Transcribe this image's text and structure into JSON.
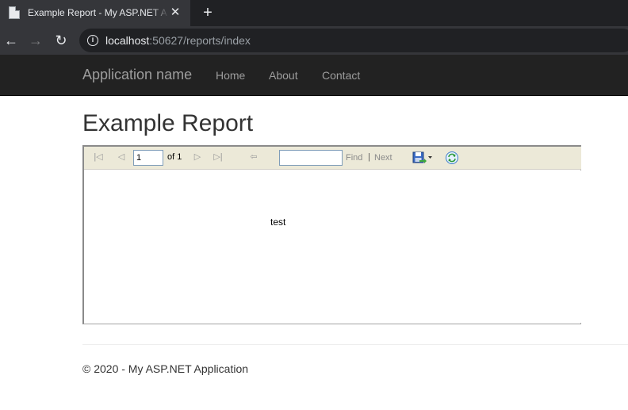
{
  "browser": {
    "tab": {
      "title": "Example Report - My ASP.NET Application",
      "close_glyph": "✕"
    },
    "new_tab_glyph": "+",
    "toolbar": {
      "back_glyph": "←",
      "forward_glyph": "→",
      "reload_glyph": "↻"
    },
    "address": {
      "host": "localhost",
      "rest": ":50627/reports/index",
      "info_glyph": "i"
    }
  },
  "navbar": {
    "brand": "Application name",
    "links": [
      "Home",
      "About",
      "Contact"
    ]
  },
  "page": {
    "title": "Example Report"
  },
  "report_viewer": {
    "current_page": "1",
    "of_label": "of 1",
    "find_value": "",
    "find_label": "Find",
    "separator": "|",
    "next_label": "Next",
    "first_glyph": "|◁",
    "prev_glyph": "◁",
    "next_glyph": "▷",
    "last_glyph": "▷|",
    "back_glyph": "⇦",
    "content_text": "test"
  },
  "footer": {
    "text": "© 2020 - My ASP.NET Application"
  }
}
